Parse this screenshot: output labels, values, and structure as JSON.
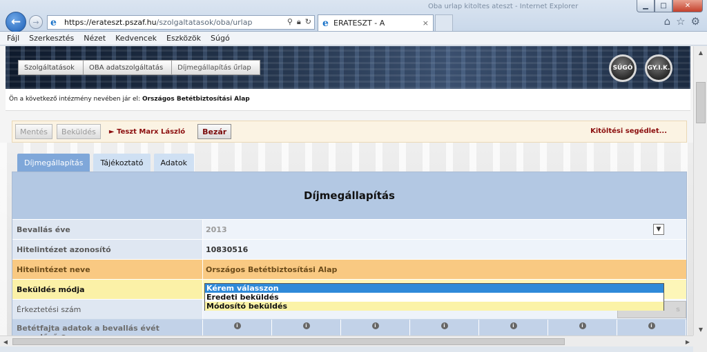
{
  "window": {
    "title": "Oba urlap kitoltes ateszt - Internet Explorer",
    "minimize": "▁",
    "maximize": "□",
    "close": "✕"
  },
  "browser": {
    "url_host": "https://erateszt.pszaf.hu",
    "url_path": "/szolgaltatasok/oba/urlap",
    "tab_title": "ERATESZT - A",
    "tab_close": "×",
    "icons": {
      "back": "back-arrow-icon",
      "forward": "forward-arrow-icon",
      "search": "search-icon",
      "lock": "lock-icon",
      "refresh": "refresh-icon",
      "home": "home-icon",
      "favorites": "star-icon",
      "tools": "gear-icon"
    }
  },
  "menu": [
    "Fájl",
    "Szerkesztés",
    "Nézet",
    "Kedvencek",
    "Eszközök",
    "Súgó"
  ],
  "breadcrumbs": [
    "Szolgáltatások",
    "OBA adatszolgáltatás",
    "Díjmegállapítás űrlap"
  ],
  "header_buttons": {
    "help": "SÚGÓ",
    "faq": "GY.I.K."
  },
  "user_line": {
    "prefix": "Ön a következő intézmény nevében jár el:",
    "institution": "Országos Betétbiztosítási Alap"
  },
  "toolbar": {
    "save": "Mentés",
    "submit": "Beküldés",
    "tester": "► Teszt Marx László",
    "close": "Bezár",
    "help_link": "Kitöltési segédlet..."
  },
  "tabs": [
    "Díjmegállapítás",
    "Tájékoztató",
    "Adatok"
  ],
  "form": {
    "title": "Díjmegállapítás",
    "rows": [
      {
        "label": "Bevallás éve",
        "value": "2013"
      },
      {
        "label": "Hitelintézet azonosító",
        "value": "10830516"
      },
      {
        "label": "Hitelintézet neve",
        "value": "Országos Betétbiztosítási Alap"
      },
      {
        "label": "Beküldés módja",
        "value": "Kérem válasszon"
      },
      {
        "label": "Érkeztetési szám",
        "value": ""
      }
    ],
    "dropdown_options": [
      "Kérem válasszon",
      "Eredeti beküldés",
      "Módosító beküldés"
    ],
    "gray_button": "s",
    "last_row_label": "Betétfajta adatok a bevallás évét megelőző"
  }
}
